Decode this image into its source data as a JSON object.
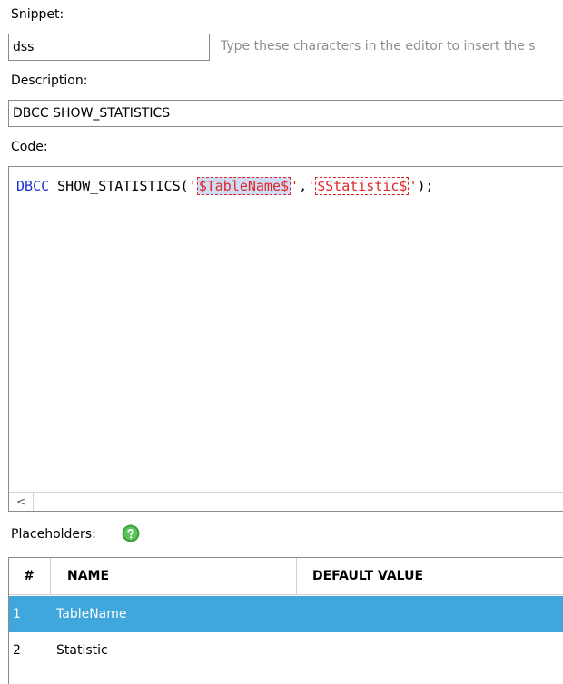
{
  "snippet": {
    "label": "Snippet:",
    "value": "dss",
    "hint": "Type these characters in the editor to insert the s"
  },
  "description": {
    "label": "Description:",
    "value": "DBCC SHOW_STATISTICS"
  },
  "code": {
    "label": "Code:",
    "keyword": "DBCC",
    "text_before": " SHOW_STATISTICS(",
    "quote": "'",
    "comma": ",",
    "placeholder1": "$TableName$",
    "placeholder2": "$Statistic$",
    "text_after": ");",
    "scroll_left_glyph": "<"
  },
  "placeholders": {
    "label": "Placeholders:",
    "help_icon": "question-mark-circle-icon",
    "columns": [
      "#",
      "NAME",
      "DEFAULT VALUE"
    ],
    "rows": [
      {
        "num": "1",
        "name": "TableName",
        "default": "",
        "selected": true
      },
      {
        "num": "2",
        "name": "Statistic",
        "default": "",
        "selected": false
      }
    ]
  },
  "colors": {
    "selected_row": "#3fa7db",
    "keyword": "#1f2fd8",
    "placeholder": "#e02626",
    "help_green": "#3aa33a"
  }
}
